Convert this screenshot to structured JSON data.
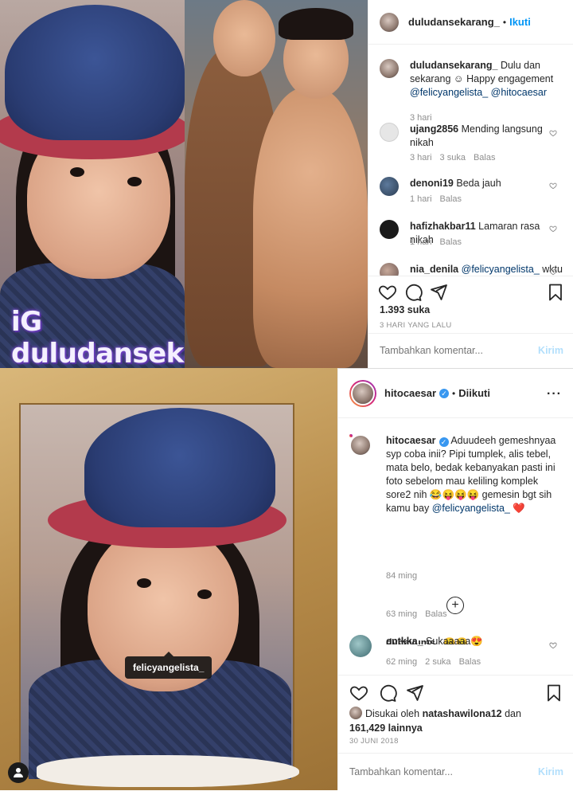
{
  "post1": {
    "watermark": "iG duludansekarang_",
    "header": {
      "username": "duludansekarang_",
      "follow_label": "Ikuti"
    },
    "caption": {
      "username": "duludansekarang_",
      "text": "Dulu dan sekarang ☺ Happy engagement",
      "mention1": "@felicyangelista_",
      "mention2": "@hitocaesar",
      "time": "3 hari"
    },
    "comments": [
      {
        "username": "ujang2856",
        "text": "Mending langsung nikah",
        "time": "3 hari",
        "likes": "3 suka",
        "reply": "Balas"
      },
      {
        "username": "denoni19",
        "text": "Beda jauh",
        "time": "1 hari",
        "likes": "",
        "reply": "Balas"
      },
      {
        "username": "hafizhakbar11",
        "text": "Lamaran rasa nikah",
        "time": "1 hari",
        "likes": "",
        "reply": "Balas"
      },
      {
        "username": "nia_denila",
        "text": "wktu",
        "mention": "@felicyangelista_"
      }
    ],
    "likes": "1.393 suka",
    "date": "3 HARI YANG LALU",
    "comment_placeholder": "Tambahkan komentar...",
    "post_label": "Kirim"
  },
  "post2": {
    "tag_label": "felicyangelista_",
    "header": {
      "username": "hitocaesar",
      "followed_label": "Diikuti"
    },
    "caption": {
      "username": "hitocaesar",
      "text": "Aduudeeh gemeshnyaa syp coba inii? Pipi tumplek, alis tebel, mata belo, bedak kebanyakan pasti ini foto sebelom mau keliling komplek sore2 nih 😂😝😝😝 gemesin bgt sih kamu bay",
      "mention": "@felicyangelista_",
      "emoji_end": "❤️",
      "time": "84 ming"
    },
    "comments": [
      {
        "username": "dyhayums_",
        "text": "😝😝",
        "time": "63 ming",
        "likes": "",
        "reply": "Balas"
      },
      {
        "username": "cntkka_",
        "text": "Sukaaaaa😍",
        "time": "62 ming",
        "likes": "2 suka",
        "reply": "Balas"
      }
    ],
    "liked_by_prefix": "Disukai oleh",
    "liked_by_user": "natashawilona12",
    "liked_by_mid": "dan",
    "liked_by_count": "161,429 lainnya",
    "date": "30 JUNI 2018",
    "comment_placeholder": "Tambahkan komentar...",
    "post_label": "Kirim"
  },
  "colors": {
    "link": "#0095f6",
    "mention": "#00376b",
    "muted": "#8e8e8e",
    "post_disabled": "#b2dffc"
  },
  "icons": [
    "heart-icon",
    "comment-icon",
    "share-icon",
    "bookmark-icon",
    "more-icon",
    "verified-icon",
    "add-comments-icon",
    "user-tag-icon"
  ]
}
